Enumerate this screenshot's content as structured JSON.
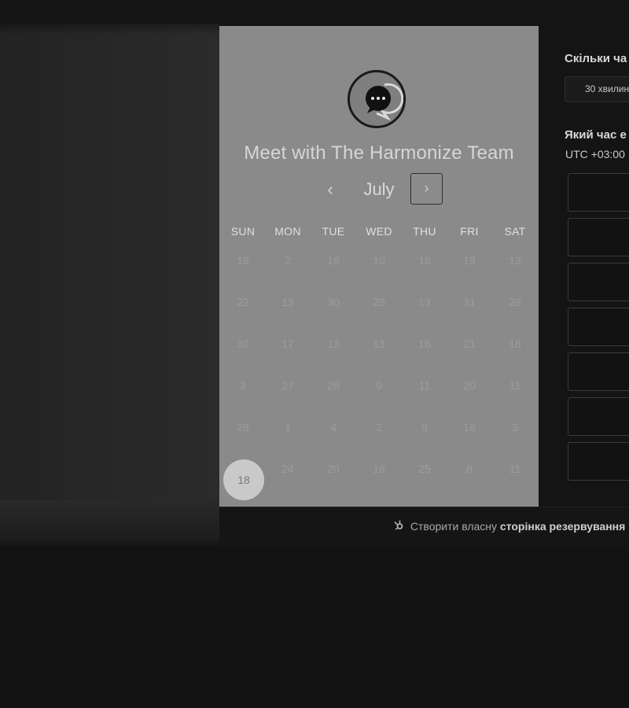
{
  "calendar": {
    "title": "Meet with The Harmonize Team",
    "month": "July",
    "prev_icon": "‹",
    "next_icon": "›",
    "weekdays": [
      "SUN",
      "MON",
      "TUE",
      "WED",
      "THU",
      "FRI",
      "SAT"
    ],
    "weeks": [
      [
        "18",
        "2",
        "16",
        "10",
        "18",
        "19",
        "13"
      ],
      [
        "22",
        "13",
        "30",
        "29",
        "13",
        "31",
        "28"
      ],
      [
        "30",
        "17",
        "13",
        "13",
        "16",
        "21",
        "18"
      ],
      [
        "3",
        "27",
        "26",
        "9",
        "11",
        "20",
        "11"
      ],
      [
        "28",
        "1",
        "4",
        "2",
        "9",
        "16",
        "3"
      ],
      [
        "18",
        "24",
        "20",
        "18",
        "25",
        "8",
        "11"
      ]
    ],
    "selected_day": "18"
  },
  "booking": {
    "duration_heading": "Скільки ча",
    "duration_value": "30 хвилин",
    "time_heading": "Який час е",
    "timezone": "UTC +03:00"
  },
  "footer": {
    "icon": "sprocket-icon",
    "text_prefix": "Створити власну",
    "text_bold": "сторінка резервування"
  }
}
